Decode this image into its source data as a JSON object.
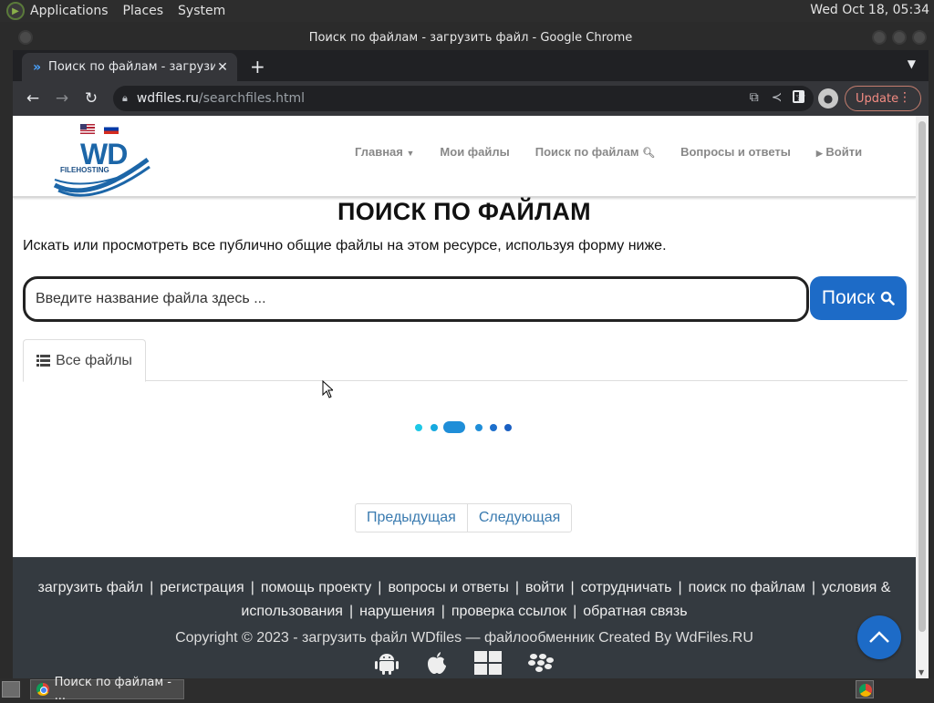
{
  "desktop": {
    "menu": [
      "Applications",
      "Places",
      "System"
    ],
    "clock": "Wed Oct 18, 05:34"
  },
  "window": {
    "title": "Поиск по файлам - загрузить файл - Google Chrome"
  },
  "browser": {
    "tab_title": "Поиск по файлам - загрузить файл",
    "url_host": "wdfiles.ru",
    "url_path": "/searchfiles.html",
    "update_label": "Update"
  },
  "site": {
    "logo_text": "WD",
    "logo_subtext": "FILEHOSTING",
    "nav": {
      "home": "Главная",
      "my_files": "Мои файлы",
      "search": "Поиск по файлам",
      "faq": "Вопросы и ответы",
      "login": "Войти"
    }
  },
  "page": {
    "title": "ПОИСК ПО ФАЙЛАМ",
    "intro": "Искать или просмотреть все публично общие файлы на этом ресурсе, используя форму ниже.",
    "search_placeholder": "Введите название файла здесь ...",
    "search_button": "Поиск",
    "tab_all_files": "Все файлы",
    "pager_prev": "Предыдущая",
    "pager_next": "Следующая",
    "loader_colors": [
      "#1ec8e6",
      "#17a9df",
      "#1f8ed8",
      "#1d6fcc",
      "#1a5fc2"
    ]
  },
  "footer": {
    "links": [
      "загрузить файл",
      "регистрация",
      "помощь проекту",
      "вопросы и ответы",
      "войти",
      "сотрудничать",
      "поиск по файлам",
      "условия & использования",
      "нарушения",
      "проверка ссылок",
      "обратная связь"
    ],
    "copyright_prefix": "Copyright © 2023 - ",
    "copyright_link": "загрузить файл WDfiles — файлообменник",
    "copyright_suffix": " Created By WdFiles.RU",
    "platform_icons": [
      "android-icon",
      "apple-icon",
      "windows-icon",
      "blackberry-icon"
    ]
  },
  "taskbar": {
    "task_title": "Поиск по файлам - ..."
  },
  "colors": {
    "accent_blue": "#1d6bc7",
    "footer_bg": "#343a40",
    "update_text": "#f28b82"
  }
}
